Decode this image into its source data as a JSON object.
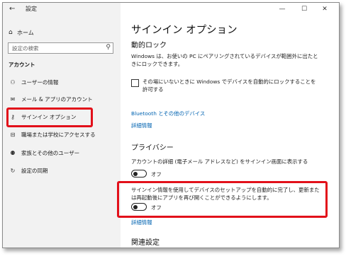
{
  "window": {
    "title": "設定",
    "controls": [
      "—",
      "☐",
      "✕"
    ]
  },
  "sidebar": {
    "home_label": "ホーム",
    "search_placeholder": "設定の検索",
    "section_label": "アカウント",
    "items": [
      {
        "label": "ユーザーの情報",
        "icon": "user-card-icon"
      },
      {
        "label": "メール & アプリのアカウント",
        "icon": "mail-icon"
      },
      {
        "label": "サインイン オプション",
        "icon": "key-icon"
      },
      {
        "label": "職場または学校にアクセスする",
        "icon": "briefcase-icon"
      },
      {
        "label": "家族とその他のユーザー",
        "icon": "people-icon"
      },
      {
        "label": "設定の同期",
        "icon": "sync-icon"
      }
    ]
  },
  "main": {
    "title": "サインイン オプション",
    "dynamic_lock": {
      "heading": "動的ロック",
      "description": "Windows は、お使いの PC にペアリングされているデバイスが範囲外に出たときにロックできます。",
      "checkbox_label": "その場にいないときに Windows でデバイスを自動的にロックすることを許可する",
      "checkbox_checked": false,
      "bluetooth_link": "Bluetooth とその他のデバイス",
      "more_info_link": "詳細情報"
    },
    "privacy": {
      "heading": "プライバシー",
      "account_details_label": "アカウントの詳細 (電子メール アドレスなど) をサインイン画面に表示する",
      "account_details_toggle": "オフ",
      "signin_info_label": "サインイン情報を使用してデバイスのセットアップを自動的に完了し、更新または再起動後にアプリを再び開くことができるようにします。",
      "signin_info_toggle": "オフ",
      "more_info_link": "詳細情報"
    },
    "related_heading": "関連設定"
  },
  "colors": {
    "highlight": "#e2101a",
    "link": "#0063b1",
    "sidebar_bg": "#f2f2f2"
  }
}
